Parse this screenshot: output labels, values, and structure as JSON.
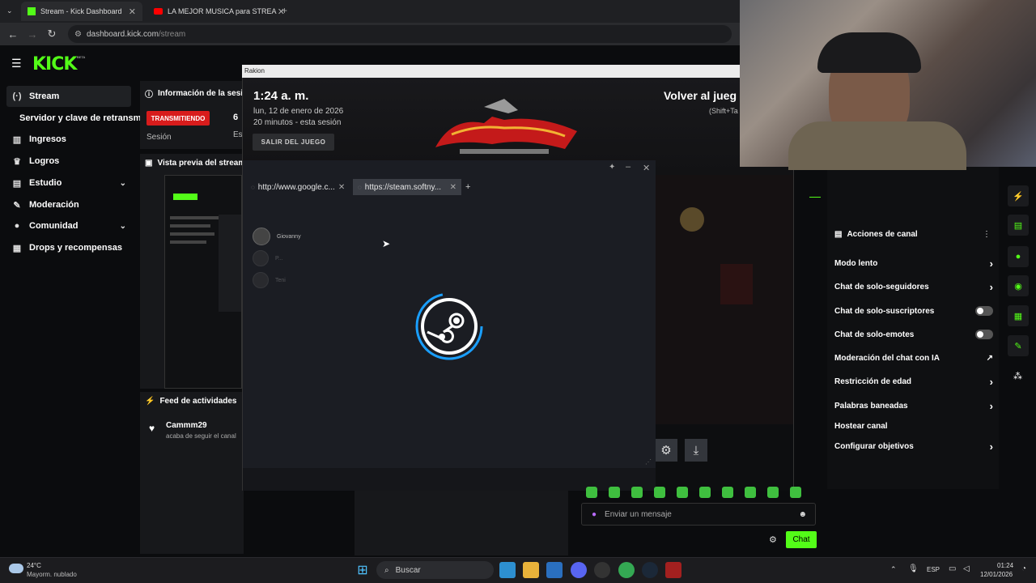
{
  "browser": {
    "tabs": [
      {
        "title": "Stream - Kick Dashboard"
      },
      {
        "title": "LA MEJOR MUSICA para STREA"
      }
    ],
    "url_host": "dashboard.kick.com",
    "url_path": "/stream"
  },
  "kick": {
    "logo": "KICK",
    "beta": "BETA",
    "sidebar": [
      {
        "label": "Stream",
        "icon": "broadcast-icon"
      },
      {
        "label": "Servidor y clave de retransm"
      },
      {
        "label": "Ingresos",
        "icon": "chart-icon"
      },
      {
        "label": "Logros",
        "icon": "trophy-icon"
      },
      {
        "label": "Estudio",
        "icon": "studio-icon"
      },
      {
        "label": "Moderación",
        "icon": "wrench-icon"
      },
      {
        "label": "Comunidad",
        "icon": "community-icon"
      },
      {
        "label": "Drops y recompensas",
        "icon": "drops-icon"
      }
    ],
    "info_panel": {
      "title": "Información de la sesió",
      "status": "TRANSMITIENDO",
      "count": "6",
      "session_label": "Sesión",
      "es_label": "Es"
    },
    "preview_panel": {
      "title": "Vista previa del stream"
    },
    "feed": {
      "title": "Feed de actividades",
      "user": "Cammm29",
      "text": "acaba de seguir el canal"
    },
    "chat_actions": {
      "title": "Acciones de canal",
      "items": [
        {
          "label": "Modo lento",
          "control": "arrow"
        },
        {
          "label": "Chat de solo-seguidores",
          "control": "arrow"
        },
        {
          "label": "Chat de solo-suscriptores",
          "control": "toggle"
        },
        {
          "label": "Chat de solo-emotes",
          "control": "toggle"
        },
        {
          "label": "Moderación del chat con IA",
          "control": "external"
        },
        {
          "label": "Restricción de edad",
          "control": "arrow"
        },
        {
          "label": "Palabras baneadas",
          "control": "arrow"
        },
        {
          "label": "Hostear canal",
          "control": "none"
        },
        {
          "label": "Configurar objetivos",
          "control": "arrow"
        }
      ]
    },
    "chat_input_placeholder": "Enviar un mensaje",
    "chat_button": "Chat",
    "accent": "#53fc18"
  },
  "rakion": {
    "window_title": "Rakion",
    "time": "1:24 a. m.",
    "date": "lun, 12 de enero de 2026",
    "session": "20 minutos - esta sesión",
    "exit_button": "SALIR DEL JUEGO",
    "return_label": "Volver al jueg",
    "shortcut": "(Shift+Ta"
  },
  "steam": {
    "tabs": [
      "http://www.google.c...",
      "https://steam.softny..."
    ],
    "new_tab": "+",
    "friends": [
      "Giovanny",
      "P...",
      "Teni"
    ]
  },
  "taskbar": {
    "weather_temp": "24°C",
    "weather_desc": "Mayorm. nublado",
    "search": "Buscar",
    "lang": "ESP",
    "time": "01:24",
    "date": "12/01/2026"
  }
}
